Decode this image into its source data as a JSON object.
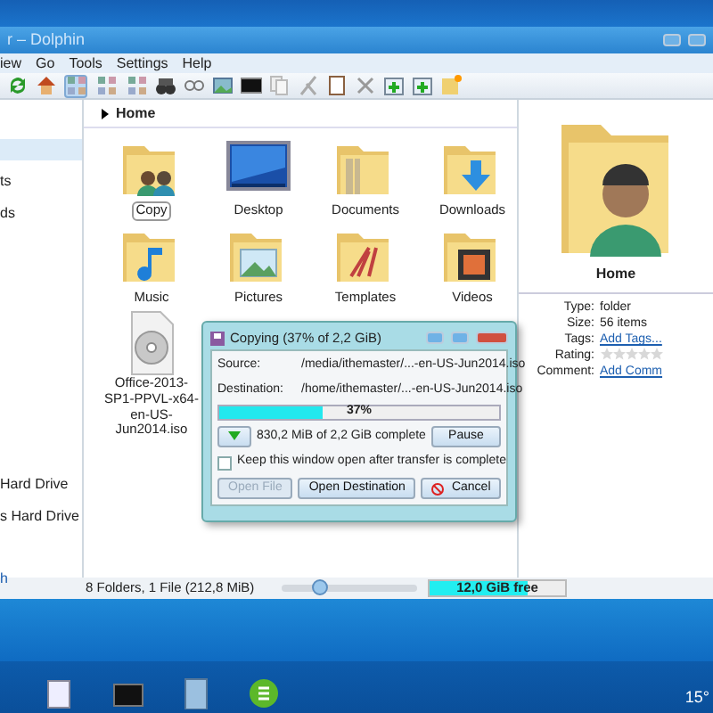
{
  "window": {
    "title": "r – Dolphin"
  },
  "menu": [
    "iew",
    "Go",
    "Tools",
    "Settings",
    "Help"
  ],
  "view_modes": [
    {
      "selected": true
    },
    {
      "selected": false
    },
    {
      "selected": false
    }
  ],
  "sidebar": {
    "items": [
      {
        "label": "ts"
      },
      {
        "label": "ds"
      },
      {
        "label": "Hard Drive"
      },
      {
        "label": "s Hard Drive"
      },
      {
        "label": "h"
      }
    ]
  },
  "breadcrumb": "Home",
  "files": [
    {
      "name": "Copy",
      "kind": "shared",
      "selected": true
    },
    {
      "name": "Desktop",
      "kind": "desktop",
      "selected": false
    },
    {
      "name": "Documents",
      "kind": "documents",
      "selected": false
    },
    {
      "name": "Downloads",
      "kind": "downloads",
      "selected": false
    },
    {
      "name": "Music",
      "kind": "music",
      "selected": false
    },
    {
      "name": "Pictures",
      "kind": "pictures",
      "selected": false
    },
    {
      "name": "Templates",
      "kind": "templates",
      "selected": false
    },
    {
      "name": "Videos",
      "kind": "videos",
      "selected": false
    },
    {
      "name": "Office-2013-SP1-PPVL-x64-en-US-Jun2014.iso",
      "kind": "disc",
      "selected": false
    }
  ],
  "info": {
    "title": "Home",
    "properties": [
      {
        "label": "Type:",
        "kind": "text",
        "value": "folder"
      },
      {
        "label": "Size:",
        "kind": "text",
        "value": "56 items"
      },
      {
        "label": "Tags:",
        "kind": "link",
        "value": "Add Tags..."
      },
      {
        "label": "Rating:",
        "kind": "rating",
        "stars": 0
      },
      {
        "label": "Comment:",
        "kind": "link",
        "value": "Add Comm"
      }
    ]
  },
  "status_bar": {
    "text": "8 Folders, 1 File (212,8 MiB)",
    "zoom": {
      "level": 0.27
    },
    "free_space": {
      "text": "12,0 GiB free",
      "level": 0.73
    }
  },
  "dialog": {
    "title": "Copying (37% of 2,2 GiB)",
    "fields": [
      {
        "label": "Source:",
        "value": "/media/ithemaster/...-en-US-Jun2014.iso"
      },
      {
        "label": "Destination:",
        "value": "/home/ithemaster/...-en-US-Jun2014.iso"
      }
    ],
    "progress": {
      "level": 0.37,
      "text": "37%"
    },
    "status": "830,2 MiB of 2,2 GiB complete",
    "pause": "Pause",
    "keep_open": {
      "label": "Keep this window open after transfer is complete",
      "checked": false
    },
    "buttons": [
      {
        "label": "Open File",
        "kind": "plain",
        "disabled": true
      },
      {
        "label": "Open Destination",
        "kind": "plain",
        "disabled": false
      },
      {
        "label": "Cancel",
        "kind": "cancel",
        "disabled": false
      }
    ]
  },
  "taskbar": {
    "clock": "15°"
  }
}
